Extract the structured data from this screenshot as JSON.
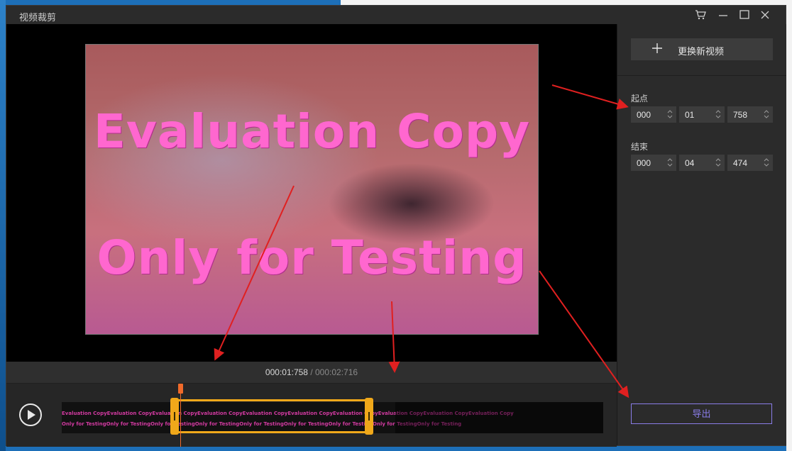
{
  "window": {
    "title": "视频裁剪"
  },
  "titlebar": {
    "icons": [
      "cart-icon",
      "minimize-icon",
      "maximize-icon",
      "close-icon"
    ]
  },
  "video": {
    "watermark_line1": "Evaluation Copy",
    "watermark_line2": "Only for Testing"
  },
  "time": {
    "current": "000:01:758",
    "separator": " / ",
    "total": "000:02:716"
  },
  "timeline": {
    "strip_row1": "Evaluation CopyEvaluation CopyEvaluation CopyEvaluation CopyEvaluation CopyEvaluation CopyEvaluation CopyEvaluation CopyEvaluation CopyEvaluation Copy",
    "strip_row2": "Only for TestingOnly for TestingOnly for TestingOnly for TestingOnly for TestingOnly for TestingOnly for TestingOnly for TestingOnly for Testing"
  },
  "sidebar": {
    "replace_label": "更换新视频",
    "start_label": "起点",
    "start": {
      "h": "000",
      "m": "01",
      "ms": "758"
    },
    "end_label": "结束",
    "end": {
      "h": "000",
      "m": "04",
      "ms": "474"
    },
    "export_label": "导出"
  },
  "colors": {
    "accent": "#8a7de8",
    "selection": "#f0a81a",
    "playhead": "#f06a2a",
    "annotation": "#e02020"
  }
}
